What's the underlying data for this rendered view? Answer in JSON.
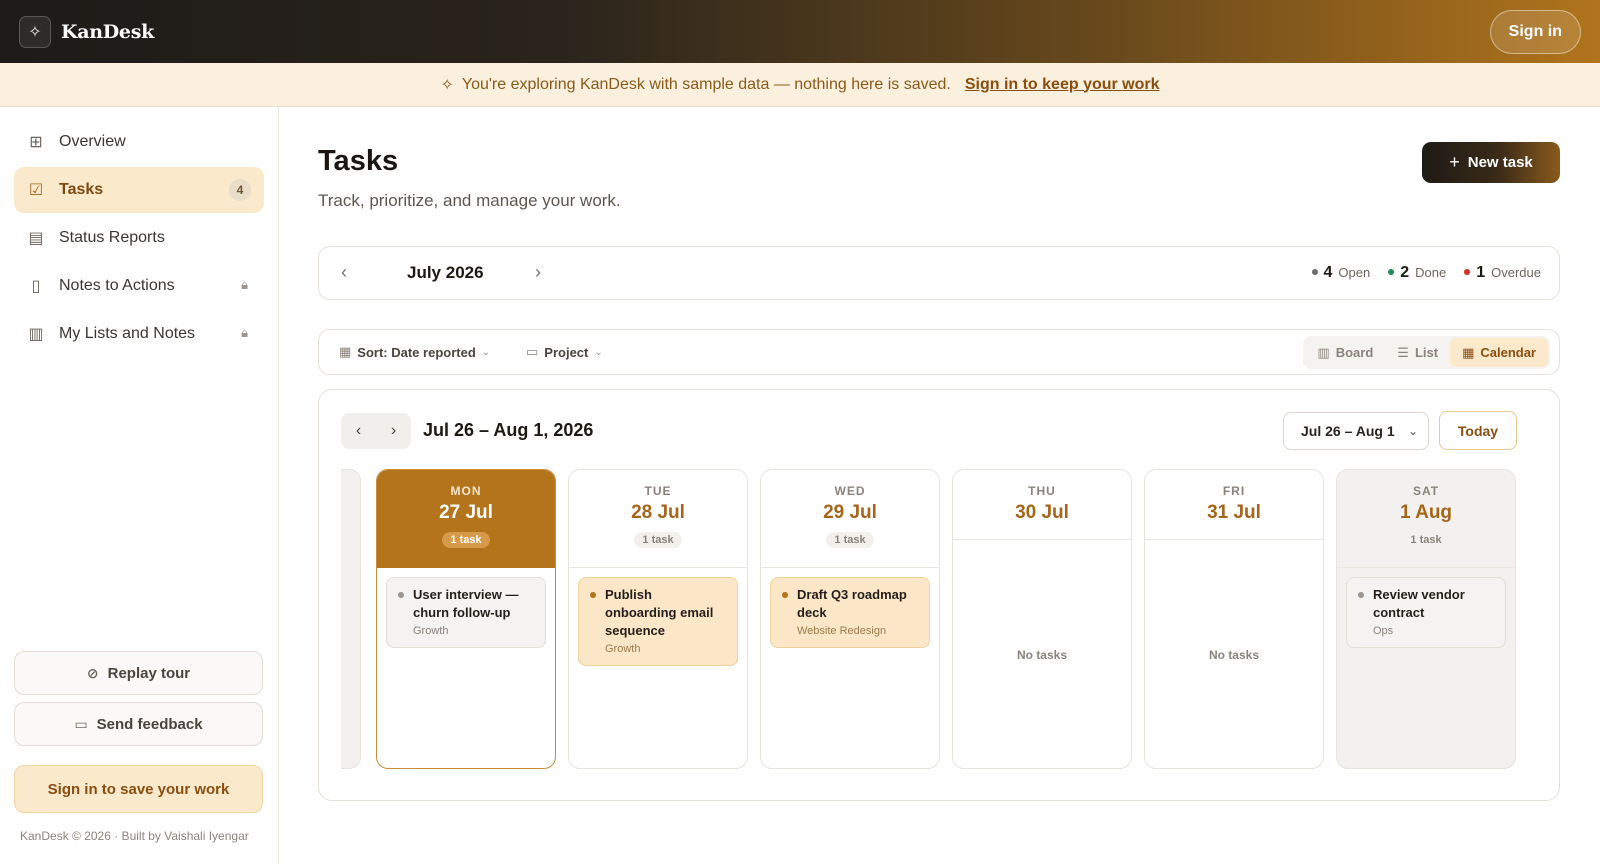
{
  "app": {
    "name": "KanDesk",
    "signin_label": "Sign in"
  },
  "banner": {
    "text": "You're exploring KanDesk with sample data — nothing here is saved.",
    "link": "Sign in to keep your work"
  },
  "sidebar": {
    "items": [
      {
        "label": "Overview",
        "icon": "grid-icon"
      },
      {
        "label": "Tasks",
        "icon": "checkbox-icon",
        "badge": "4",
        "active": true
      },
      {
        "label": "Status Reports",
        "icon": "document-icon"
      },
      {
        "label": "Notes to Actions",
        "icon": "file-icon",
        "locked": true
      },
      {
        "label": "My Lists and Notes",
        "icon": "clipboard-icon",
        "locked": true
      }
    ],
    "replay_label": "Replay tour",
    "feedback_label": "Send feedback",
    "signin_label": "Sign in to save your work",
    "credit": "KanDesk © 2026 · Built by Vaishali Iyengar"
  },
  "page": {
    "title": "Tasks",
    "subtitle": "Track, prioritize, and manage your work.",
    "new_task_label": "New task"
  },
  "month_bar": {
    "label": "July 2026",
    "stats": [
      {
        "count": "4",
        "label": "Open",
        "color": "#6b6b6b"
      },
      {
        "count": "2",
        "label": "Done",
        "color": "#1f8a5a"
      },
      {
        "count": "1",
        "label": "Overdue",
        "color": "#d92a2a"
      }
    ]
  },
  "toolbar": {
    "sort_label": "Sort: Date reported",
    "project_label": "Project",
    "views": [
      "Board",
      "List",
      "Calendar"
    ],
    "active_view": "Calendar"
  },
  "calendar": {
    "week_label": "Jul 26 – Aug 1, 2026",
    "range_select": "Jul 26 – Aug 1",
    "today_label": "Today",
    "days": [
      {
        "dow": "MON",
        "date": "27 Jul",
        "count": "1 task",
        "today": true,
        "tasks": [
          {
            "title": "User interview — churn follow-up",
            "project": "Growth",
            "style": "neutral"
          }
        ]
      },
      {
        "dow": "TUE",
        "date": "28 Jul",
        "count": "1 task",
        "tasks": [
          {
            "title": "Publish onboarding email sequence",
            "project": "Growth",
            "style": "warm"
          }
        ]
      },
      {
        "dow": "WED",
        "date": "29 Jul",
        "count": "1 task",
        "tasks": [
          {
            "title": "Draft Q3 roadmap deck",
            "project": "Website Redesign",
            "style": "warm"
          }
        ]
      },
      {
        "dow": "THU",
        "date": "30 Jul",
        "empty": "No tasks",
        "tasks": []
      },
      {
        "dow": "FRI",
        "date": "31 Jul",
        "empty": "No tasks",
        "tasks": []
      },
      {
        "dow": "SAT",
        "date": "1 Aug",
        "count": "1 task",
        "weekend": true,
        "tasks": [
          {
            "title": "Review vendor contract",
            "project": "Ops",
            "style": "neutral"
          }
        ]
      }
    ]
  },
  "colors": {
    "accent": "#b4741c",
    "accent_soft": "#fbe9cc",
    "banner_bg": "#fbf0dd"
  }
}
